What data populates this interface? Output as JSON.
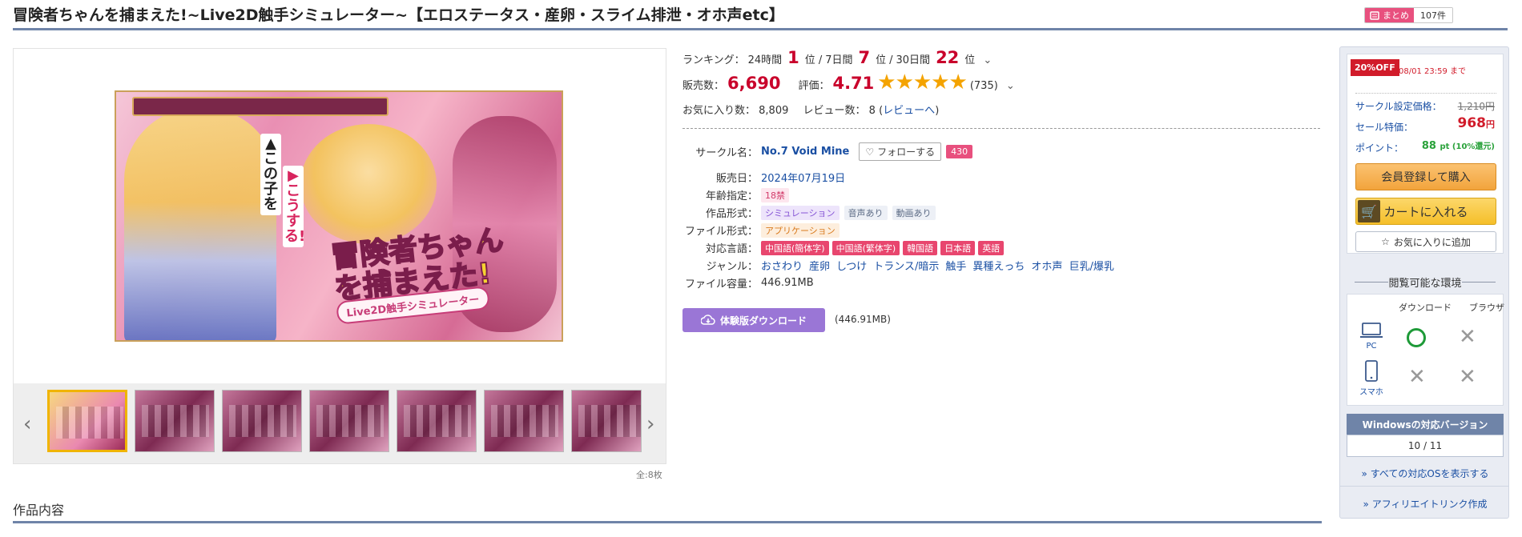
{
  "header": {
    "title": "冒険者ちゃんを捕まえた!~Live2D触手シミュレーター~【エロステータス・産卵・スライム排泄・オホ声etc】",
    "matome_label": "まとめ",
    "matome_count": "107件"
  },
  "gallery": {
    "main_image": {
      "logo_text": "冒険者ちゃんを捕まえた!",
      "sub_text": "Live2D触手シミュレーター",
      "callout_1": "▲この子を",
      "callout_2": "▶こうする!"
    },
    "total": "全:8枚",
    "prev_icon": "chevron-left-icon",
    "next_icon": "chevron-right-icon"
  },
  "section": {
    "title": "作品内容"
  },
  "ranking": {
    "label": "ランキング：",
    "d24_label": "24時間",
    "d24_value": "1",
    "d24_unit": "位",
    "sep1": "/",
    "d7_label": "7日間",
    "d7_value": "7",
    "d7_unit": "位",
    "sep2": "/",
    "d30_label": "30日間",
    "d30_value": "22",
    "d30_unit": "位"
  },
  "stats": {
    "sales_label": "販売数：",
    "sales_value": "6,690",
    "rating_label": "評価：",
    "rating_value": "4.71",
    "stars": "★★★★★",
    "rating_count": "(735)",
    "favorites_label": "お気に入り数：",
    "favorites_value": "8,809",
    "reviews_label": "レビュー数：",
    "reviews_value": "8",
    "reviews_link_prefix": "(",
    "reviews_link": "レビューへ",
    "reviews_link_suffix": ")"
  },
  "spec": {
    "circle_label": "サークル名：",
    "circle_name": "No.7 Void Mine",
    "follow_label": "フォローする",
    "follow_count": "430",
    "release_label": "販売日：",
    "release_value": "2024年07月19日",
    "age_label": "年齢指定：",
    "age_value": "18禁",
    "format_label": "作品形式：",
    "format_tags": [
      "シミュレーション",
      "音声あり",
      "動画あり"
    ],
    "filetype_label": "ファイル形式：",
    "filetype_value": "アプリケーション",
    "lang_label": "対応言語：",
    "languages": [
      "中国語(簡体字)",
      "中国語(繁体字)",
      "韓国語",
      "日本語",
      "英語"
    ],
    "genre_label": "ジャンル：",
    "genres": [
      "おさわり",
      "産卵",
      "しつけ",
      "トランス/暗示",
      "触手",
      "異種えっち",
      "オホ声",
      "巨乳/爆乳"
    ],
    "size_label": "ファイル容量：",
    "size_value": "446.91MB"
  },
  "trial": {
    "button_label": "体験版ダウンロード",
    "size": "(446.91MB)"
  },
  "purchase": {
    "discount": "20%OFF",
    "until": "08/01 23:59 まで",
    "list_price_label": "サークル設定価格：",
    "list_price": "1,210円",
    "sale_label": "セール特価：",
    "sale_price": "968",
    "sale_unit": "円",
    "points_label": "ポイント：",
    "points_value": "88",
    "points_unit": "pt (10%還元)",
    "member_button": "会員登録して購入",
    "cart_button": "カートに入れる",
    "fav_button": "お気に入りに追加"
  },
  "environment": {
    "title": "閲覧可能な環境",
    "col_download": "ダウンロード",
    "col_browser": "ブラウザ",
    "pc_label": "PC",
    "phone_label": "スマホ",
    "pc_download": "available",
    "pc_browser": "unavailable",
    "phone_download": "unavailable",
    "phone_browser": "unavailable",
    "windows_header": "Windowsの対応バージョン",
    "windows_value": "10 / 11",
    "all_os_link": "すべての対応OSを表示する",
    "affiliate_link": "アフィリエイトリンク作成",
    "link_prefix": "»"
  },
  "colors": {
    "accent": "#c9002b",
    "rule": "#6f84a8",
    "link": "#1a4fa3",
    "sale_red": "#d11b2a",
    "points_green": "#2aa23b"
  }
}
